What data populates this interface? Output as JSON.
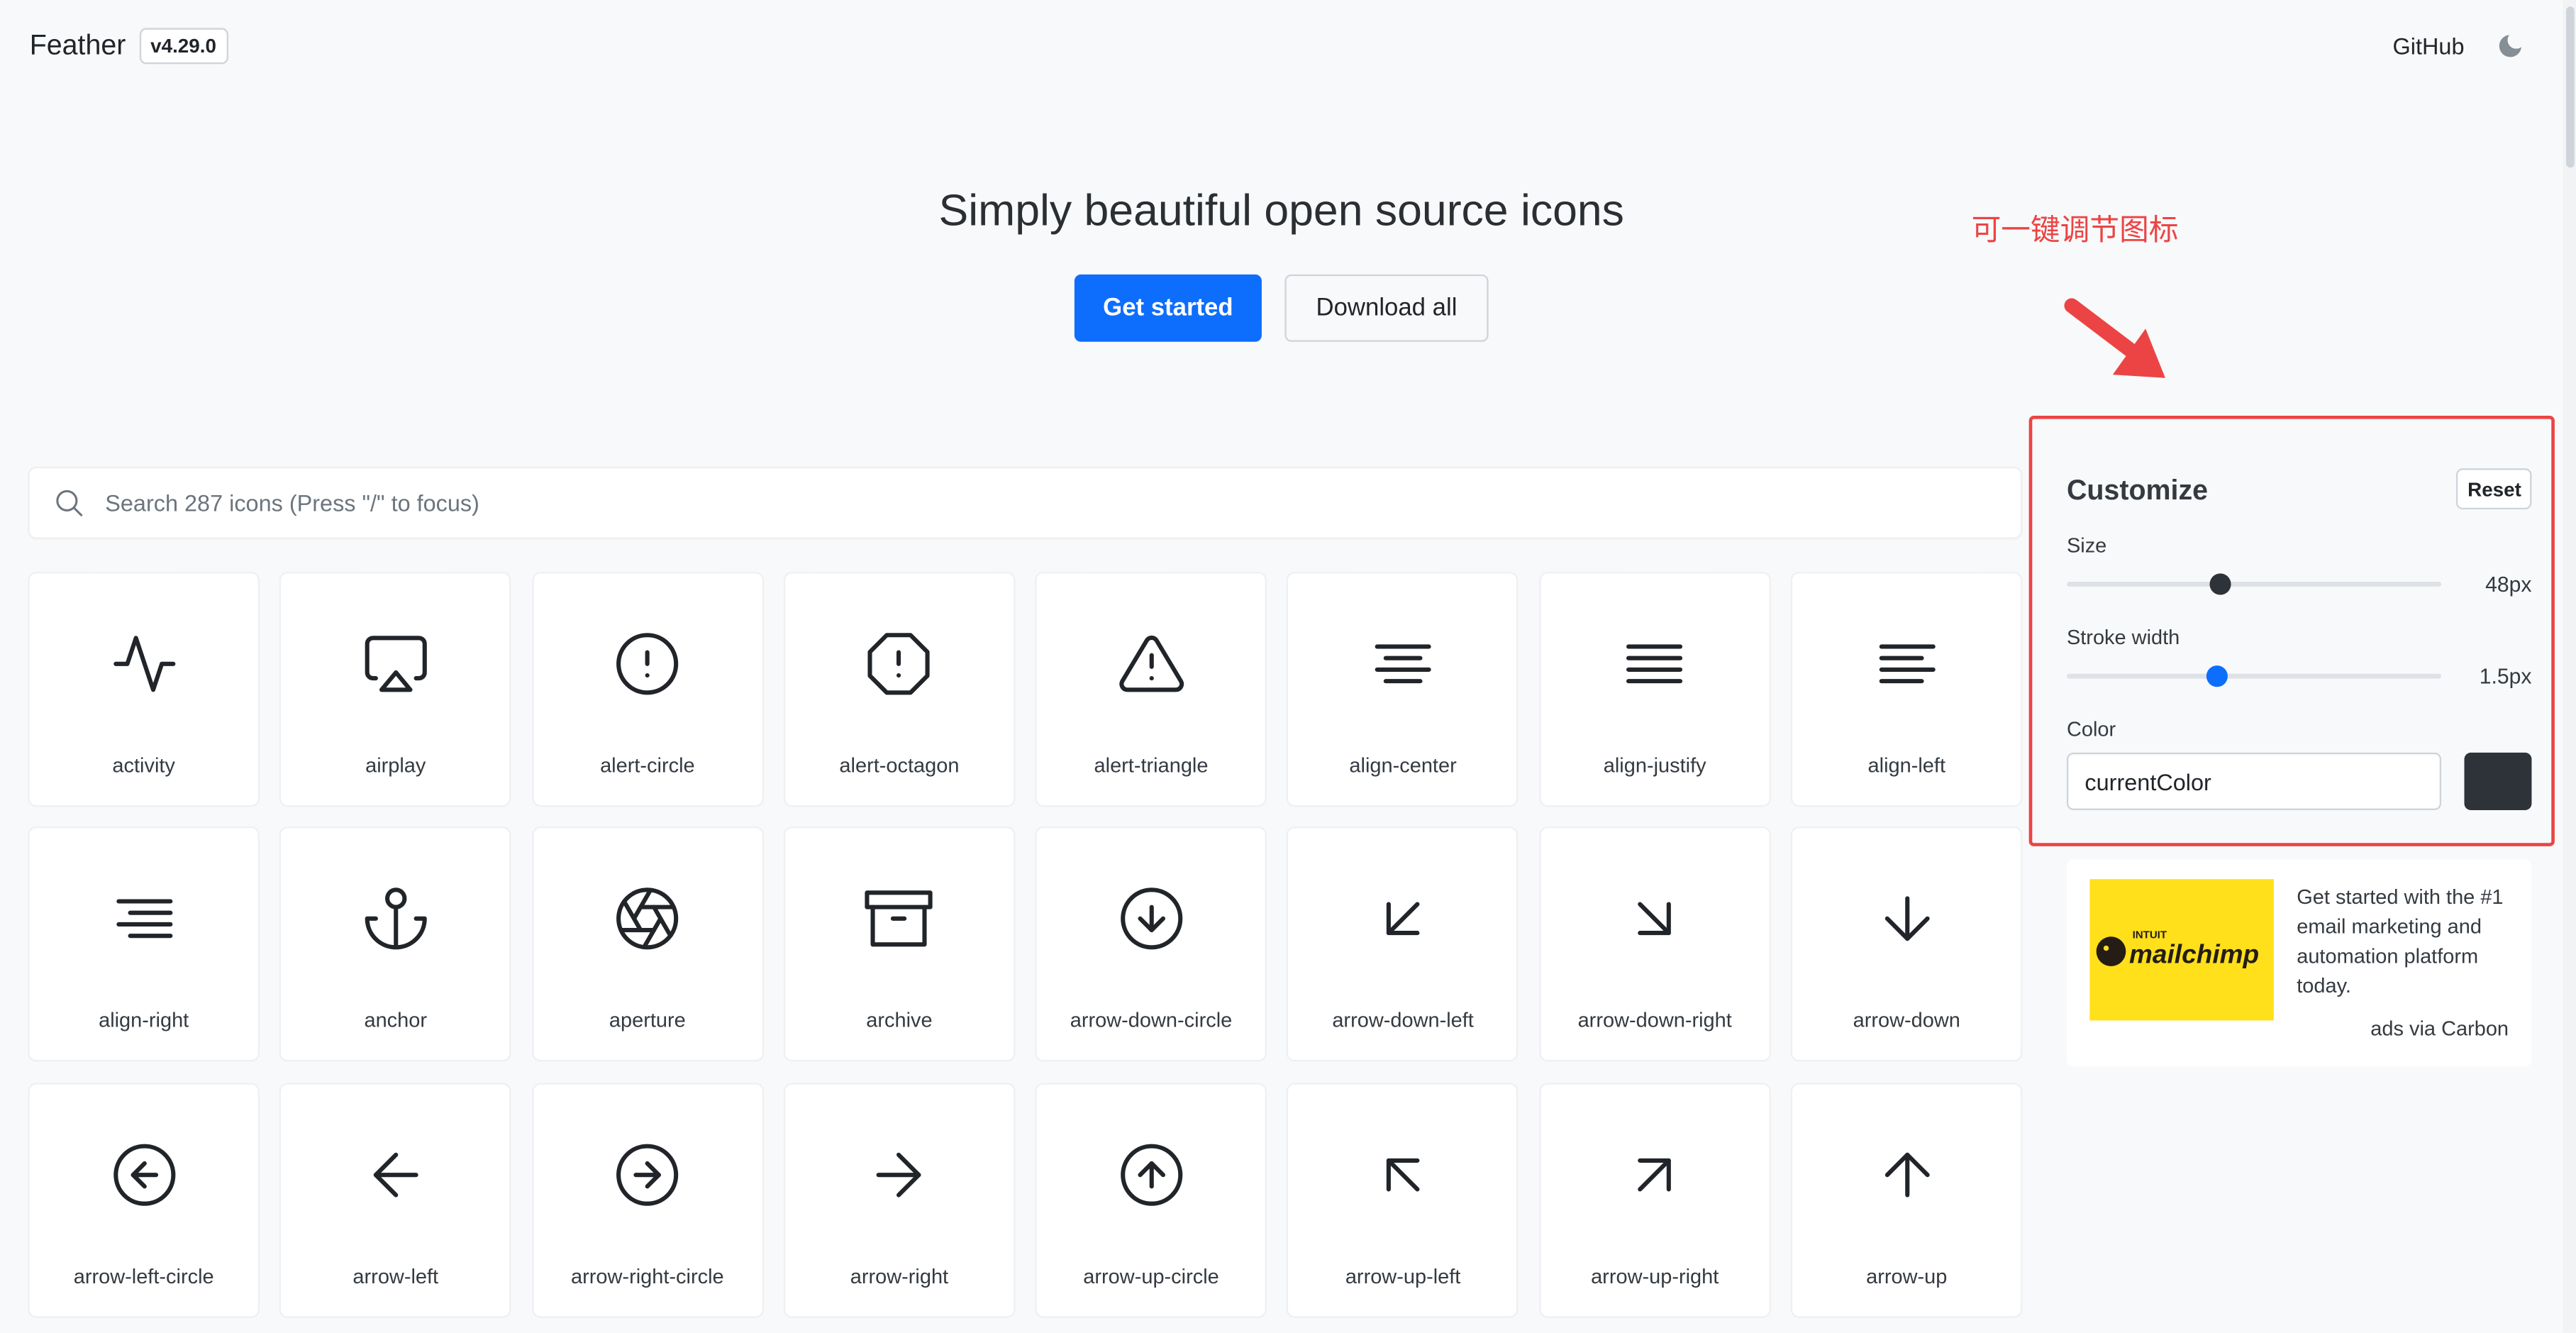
{
  "header": {
    "brand": "Feather",
    "version": "v4.29.0",
    "github": "GitHub"
  },
  "hero": {
    "title": "Simply beautiful open source icons",
    "primary_button": "Get started",
    "secondary_button": "Download all"
  },
  "annotation": {
    "text": "可一键调节图标",
    "color": "#ec4444"
  },
  "search": {
    "placeholder": "Search 287 icons (Press \"/\" to focus)"
  },
  "icons": [
    "activity",
    "airplay",
    "alert-circle",
    "alert-octagon",
    "alert-triangle",
    "align-center",
    "align-justify",
    "align-left",
    "align-right",
    "anchor",
    "aperture",
    "archive",
    "arrow-down-circle",
    "arrow-down-left",
    "arrow-down-right",
    "arrow-down",
    "arrow-left-circle",
    "arrow-left",
    "arrow-right-circle",
    "arrow-right",
    "arrow-up-circle",
    "arrow-up-left",
    "arrow-up-right",
    "arrow-up"
  ],
  "customize": {
    "title": "Customize",
    "reset": "Reset",
    "size": {
      "label": "Size",
      "value": "48px",
      "fraction": 0.41
    },
    "stroke": {
      "label": "Stroke width",
      "value": "1.5px",
      "fraction": 0.4
    },
    "color": {
      "label": "Color",
      "value": "currentColor",
      "swatch": "#2d3338"
    },
    "accent": "#0d6efd"
  },
  "ad": {
    "brand_small": "INTUIT",
    "brand": "mailchimp",
    "text": "Get started with the #1 email marketing and automation platform today.",
    "via": "ads via Carbon"
  }
}
